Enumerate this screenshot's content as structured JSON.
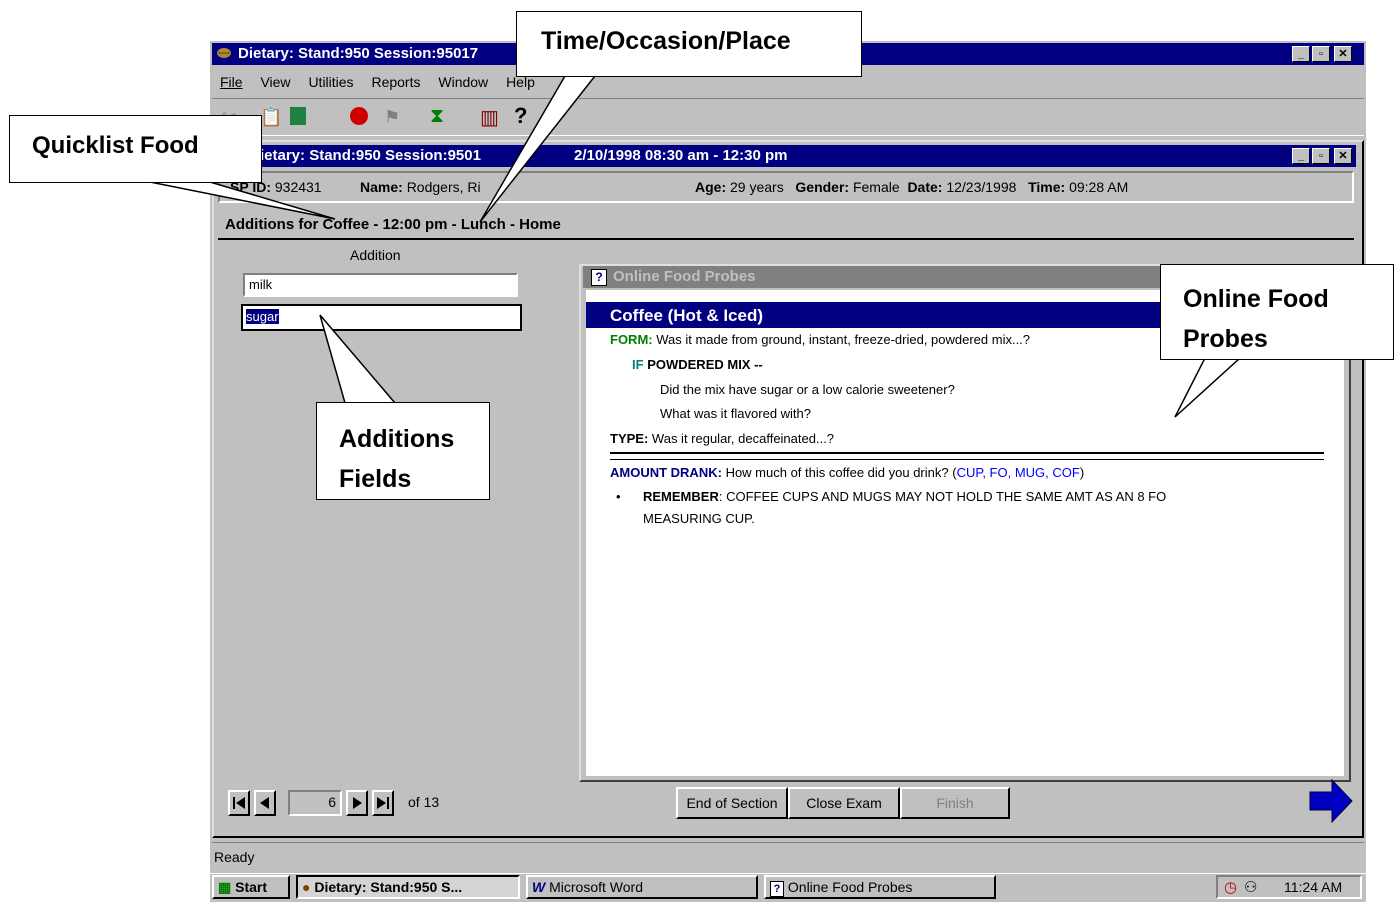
{
  "app": {
    "title": "Dietary: Stand:950 Session:95017",
    "menu": [
      "File",
      "View",
      "Utilities",
      "Reports",
      "Window",
      "Help"
    ]
  },
  "child": {
    "title": "Dietary: Stand:950 Session:95017 - 12/10/1998 08:30 am - 12:30 pm",
    "title_visible": "ietary: Stand:950 Session:9501",
    "title_visible2": "2/10/1998 08:30 am - 12:30 pm"
  },
  "patient": {
    "sp_id_label": "SP ID:",
    "sp_id": "932431",
    "name_label": "Name:",
    "name": "Rodgers, Ri",
    "age_label": "Age:",
    "age": "29 years",
    "gender_label": "Gender:",
    "gender": "Female",
    "date_label": "Date:",
    "date": "12/23/1998",
    "time_label": "Time:",
    "time": "09:28 AM"
  },
  "section": {
    "heading": "Additions for Coffee - 12:00 pm - Lunch - Home",
    "column_header": "Addition",
    "additions": [
      "milk",
      "sugar"
    ]
  },
  "probes": {
    "window_title": "Online Food Probes",
    "food": "Coffee (Hot & Iced)",
    "form_label": "FORM:",
    "form_text": "Was it made from ground, instant, freeze-dried, powdered mix...?",
    "if_label": "IF",
    "if_text": "POWDERED MIX --",
    "q1": "Did the mix have sugar or a low calorie sweetener?",
    "q2": "What was it flavored with?",
    "type_label": "TYPE:",
    "type_text": "Was it regular, decaffeinated...?",
    "amount_label": "AMOUNT DRANK:",
    "amount_text": "How much of this coffee did you drink?  (",
    "amount_units": "CUP, FO, MUG, COF",
    "amount_close": ")",
    "remember_label": "REMEMBER",
    "remember_text1": ":  COFFEE CUPS AND MUGS MAY NOT HOLD THE SAME AMT AS AN 8 FO",
    "remember_text2": "MEASURING CUP."
  },
  "navigation": {
    "current": "6",
    "of_text": "of 13"
  },
  "buttons": {
    "end_section": "End of Section",
    "close_exam": "Close Exam",
    "finish": "Finish"
  },
  "status": "Ready",
  "taskbar": {
    "start": "Start",
    "items": [
      "Dietary: Stand:950 S...",
      "Microsoft Word",
      "Online Food Probes"
    ],
    "clock": "11:24 AM"
  },
  "callouts": {
    "time_place": "Time/Occasion/Place",
    "quicklist": "Quicklist Food",
    "additions_line1": "Additions",
    "additions_line2": "Fields",
    "probes_line1": "Online Food",
    "probes_line2": "Probes"
  },
  "colors": {
    "titlebar": "#000080",
    "window_bg": "#c0c0c0",
    "form_green": "#008000",
    "teal": "#008080",
    "link_blue": "#0000ff"
  }
}
